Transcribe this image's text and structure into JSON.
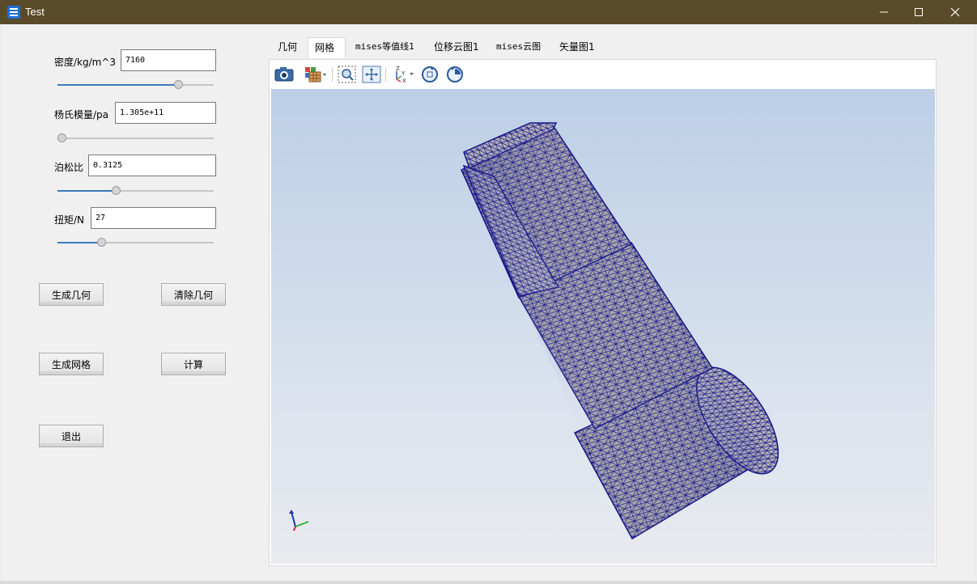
{
  "window": {
    "title": "Test",
    "app_icon": "app-icon",
    "controls": [
      "minimize-icon",
      "maximize-icon",
      "close-icon"
    ]
  },
  "params": {
    "density": {
      "label": "密度/kg/m^3",
      "value": "7160",
      "slider": 0.79
    },
    "youngs": {
      "label": "杨氏模量/pa",
      "value": "1.305e+11",
      "slider": 0.0
    },
    "poisson": {
      "label": "泊松比",
      "value": "0.3125",
      "slider": 0.37
    },
    "torque": {
      "label": "扭矩/N",
      "value": "27",
      "slider": 0.27
    }
  },
  "buttons": {
    "generate_geometry": "生成几何",
    "clear_geometry": "清除几何",
    "generate_mesh": "生成网格",
    "compute": "计算",
    "exit": "退出"
  },
  "tabs": [
    {
      "label": "几何",
      "active": false
    },
    {
      "label": "网格",
      "active": true
    },
    {
      "label": "mises等值线1",
      "active": false
    },
    {
      "label": "位移云图1",
      "active": false
    },
    {
      "label": "mises云图",
      "active": false
    },
    {
      "label": "矢量图1",
      "active": false
    }
  ],
  "toolbar": [
    "camera-icon",
    "display-mode-icon",
    "zoom-window-icon",
    "fit-all-icon",
    "axis-view-icon",
    "rotate-left-icon",
    "rotate-right-icon"
  ],
  "colors": {
    "titlebar": "#594a2a",
    "mesh_edge": "#14148a",
    "mesh_face": "#a29fa6",
    "slider_fill": "#3d7ab8"
  }
}
